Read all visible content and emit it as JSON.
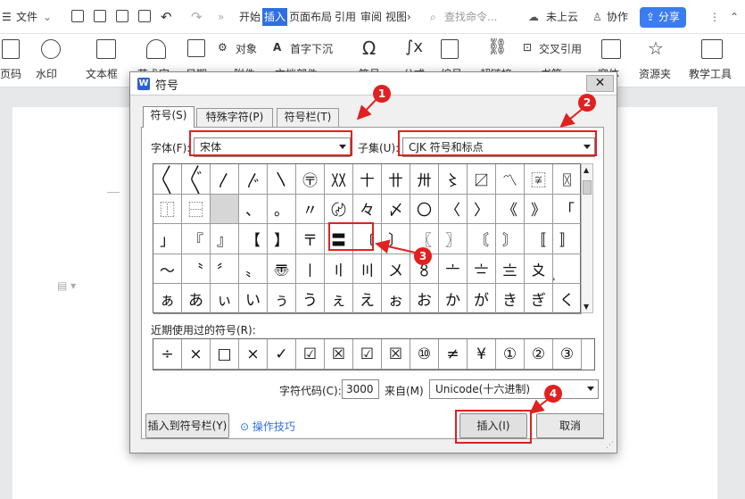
{
  "topbar": {
    "menu_label": "文件",
    "tabs": [
      "开始",
      "插入",
      "页面布局",
      "引用",
      "审阅",
      "视图"
    ],
    "active_tab": "插入",
    "search_placeholder": "查找命令...",
    "cloud": "未上云",
    "collab": "协作",
    "share": "分享"
  },
  "ribbon": {
    "items": [
      "页码",
      "水印",
      "文本框",
      "艺术字",
      "日期",
      "附件",
      "对象",
      "文档部件",
      "首字下沉",
      "符号",
      "公式",
      "编号",
      "超链接",
      "交叉引用",
      "书签",
      "窗体",
      "资源夹",
      "教学工具"
    ]
  },
  "dialog": {
    "title": "符号",
    "tabs": [
      "符号(S)",
      "特殊字符(P)",
      "符号栏(T)"
    ],
    "font_label": "字体(F):",
    "font_value": "宋体",
    "subset_label": "子集(U):",
    "subset_value": "CJK 符号和标点",
    "grid": [
      [
        "〱",
        "〲",
        "〳",
        "〴",
        "〵",
        "〶",
        "〷",
        "〸",
        "〹",
        "〺",
        "〻",
        "〼",
        "〽",
        "〾",
        "〿"
      ],
      [
        "⿰",
        "⿱",
        "",
        "、",
        "。",
        "〃",
        "〄",
        "々",
        "〆",
        "〇",
        "〈",
        "〉",
        "《",
        "》",
        "「"
      ],
      [
        "」",
        "『",
        "』",
        "【",
        "】",
        "〒",
        "〓",
        "〔",
        "〕",
        "〖",
        "〗",
        "〘",
        "〙",
        "〚",
        "〛"
      ],
      [
        "〜",
        "〝",
        "〞",
        "〟",
        "〠",
        "〡",
        "〢",
        "〣",
        "〤",
        "〥",
        "〦",
        "〧",
        "〨",
        "〩",
        "〪"
      ],
      [
        "ぁ",
        "あ",
        "ぃ",
        "い",
        "ぅ",
        "う",
        "ぇ",
        "え",
        "ぉ",
        "お",
        "か",
        "が",
        "き",
        "ぎ",
        "く"
      ]
    ],
    "recent_label": "近期使用过的符号(R):",
    "recent": [
      "÷",
      "×",
      "□",
      "×",
      "✓",
      "☑",
      "☒",
      "☑",
      "☒",
      "⑩",
      "≠",
      "¥",
      "①",
      "②",
      "③"
    ],
    "charcode_label": "字符代码(C):",
    "charcode_value": "3000",
    "from_label": "来自(M)",
    "from_value": "Unicode(十六进制)",
    "insert_to_bar": "插入到符号栏(Y)",
    "tips": "操作技巧",
    "insert": "插入(I)",
    "cancel": "取消"
  },
  "callouts": [
    "1",
    "2",
    "3",
    "4"
  ],
  "colors": {
    "accent": "#2f6fe4",
    "callout": "#e12020"
  }
}
